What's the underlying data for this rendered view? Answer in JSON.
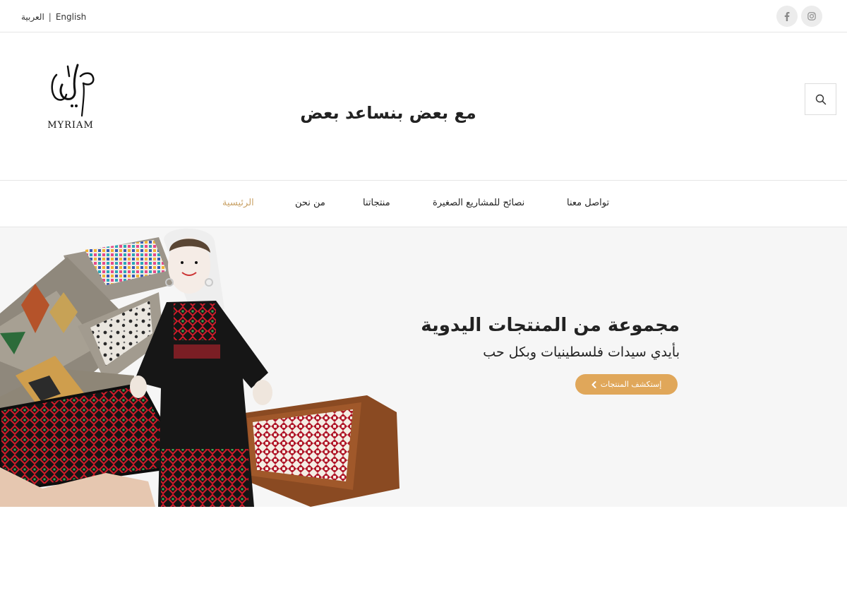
{
  "topbar": {
    "lang_arabic": "العربية",
    "lang_separator": "|",
    "lang_english": "English",
    "social_icons": [
      "facebook-icon",
      "instagram-icon"
    ]
  },
  "header": {
    "logo_text": "MYRIAM",
    "tagline": "مع بعض بنساعد بعض",
    "search_icon": "search-icon"
  },
  "nav": {
    "items": [
      {
        "label": "تواصل معنا"
      },
      {
        "label": "نصائح للمشاريع الصغيرة"
      },
      {
        "label": "منتجاتنا"
      },
      {
        "label": "من نحن"
      },
      {
        "label": "الرئيسية"
      }
    ],
    "active_color": "#c9a267"
  },
  "hero": {
    "title": "مجموعة من المنتجات اليدوية",
    "subtitle": "بأيدي سيدات فلسطينيات وبكل حب",
    "button_label": "إستكشف المنتجات",
    "button_color": "#e0a75a"
  }
}
